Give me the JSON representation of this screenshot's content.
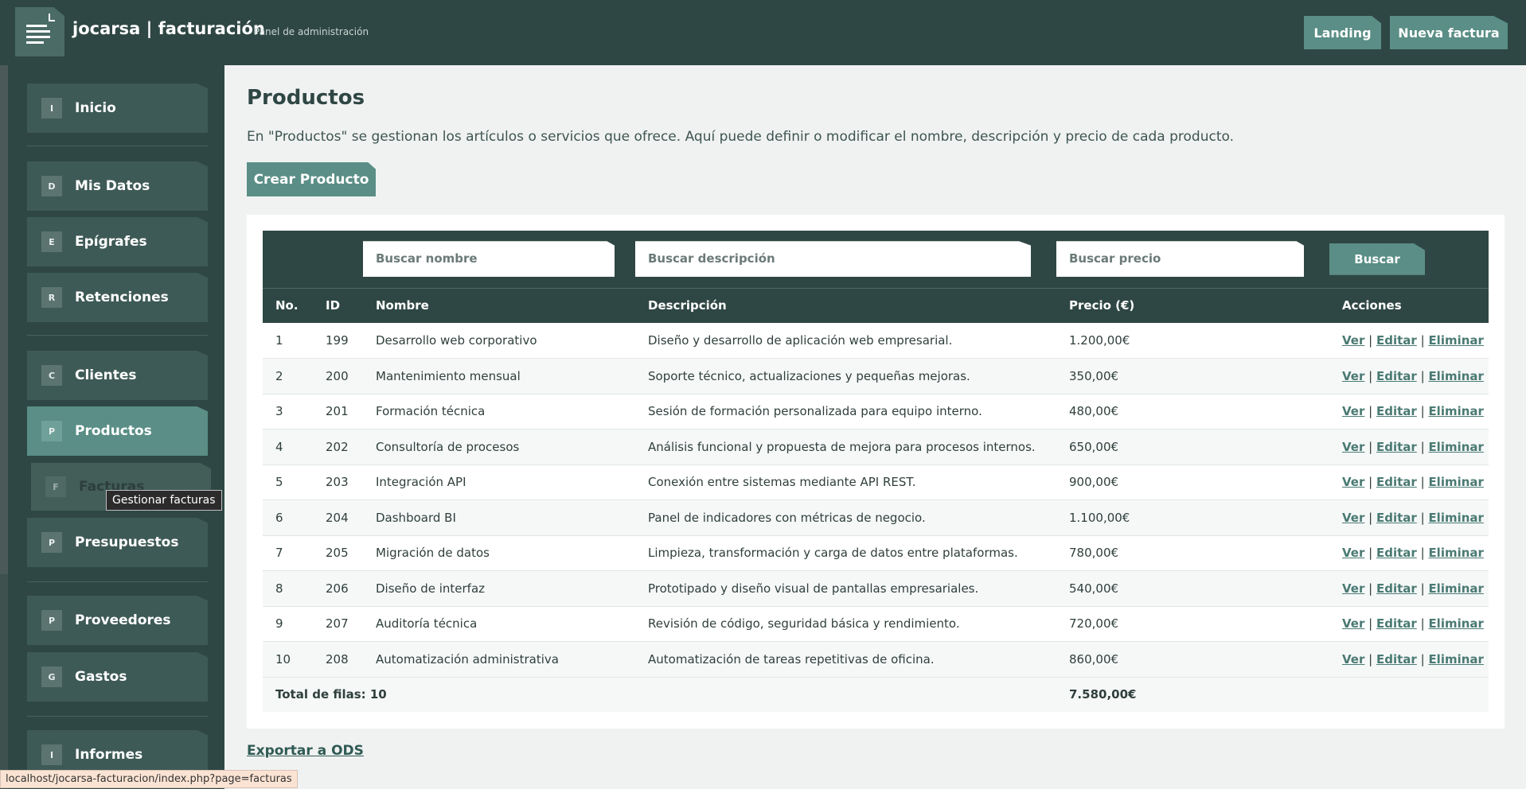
{
  "header": {
    "title": "jocarsa | facturación",
    "subtitle": "Panel de administración",
    "buttons": {
      "landing": "Landing",
      "new_invoice": "Nueva factura"
    }
  },
  "sidebar": {
    "items": [
      {
        "badge": "I",
        "label": "Inicio"
      },
      {
        "badge": "D",
        "label": "Mis Datos"
      },
      {
        "badge": "E",
        "label": "Epígrafes"
      },
      {
        "badge": "R",
        "label": "Retenciones"
      },
      {
        "badge": "C",
        "label": "Clientes"
      },
      {
        "badge": "P",
        "label": "Productos"
      },
      {
        "badge": "P",
        "label": "Presupuestos"
      },
      {
        "badge": "P",
        "label": "Proveedores"
      },
      {
        "badge": "G",
        "label": "Gastos"
      },
      {
        "badge": "I",
        "label": "Informes"
      }
    ],
    "active": "Productos",
    "hover_item": {
      "badge": "F",
      "label": "Facturas"
    },
    "tooltip": "Gestionar facturas"
  },
  "main": {
    "title": "Productos",
    "description": "En \"Productos\" se gestionan los artículos o servicios que ofrece. Aquí puede definir o modificar el nombre, descripción y precio de cada producto.",
    "create_button": "Crear Producto",
    "filters": {
      "name_placeholder": "Buscar nombre",
      "description_placeholder": "Buscar descripción",
      "price_placeholder": "Buscar precio",
      "search_button": "Buscar"
    },
    "table": {
      "headers": [
        "No.",
        "ID",
        "Nombre",
        "Descripción",
        "Precio (€)",
        "Acciones"
      ],
      "rows": [
        {
          "no": "1",
          "id": "199",
          "name": "Desarrollo web corporativo",
          "description": "Diseño y desarrollo de aplicación web empresarial.",
          "price": "1.200,00€"
        },
        {
          "no": "2",
          "id": "200",
          "name": "Mantenimiento mensual",
          "description": "Soporte técnico, actualizaciones y pequeñas mejoras.",
          "price": "350,00€"
        },
        {
          "no": "3",
          "id": "201",
          "name": "Formación técnica",
          "description": "Sesión de formación personalizada para equipo interno.",
          "price": "480,00€"
        },
        {
          "no": "4",
          "id": "202",
          "name": "Consultoría de procesos",
          "description": "Análisis funcional y propuesta de mejora para procesos internos.",
          "price": "650,00€"
        },
        {
          "no": "5",
          "id": "203",
          "name": "Integración API",
          "description": "Conexión entre sistemas mediante API REST.",
          "price": "900,00€"
        },
        {
          "no": "6",
          "id": "204",
          "name": "Dashboard BI",
          "description": "Panel de indicadores con métricas de negocio.",
          "price": "1.100,00€"
        },
        {
          "no": "7",
          "id": "205",
          "name": "Migración de datos",
          "description": "Limpieza, transformación y carga de datos entre plataformas.",
          "price": "780,00€"
        },
        {
          "no": "8",
          "id": "206",
          "name": "Diseño de interfaz",
          "description": "Prototipado y diseño visual de pantallas empresariales.",
          "price": "540,00€"
        },
        {
          "no": "9",
          "id": "207",
          "name": "Auditoría técnica",
          "description": "Revisión de código, seguridad básica y rendimiento.",
          "price": "720,00€"
        },
        {
          "no": "10",
          "id": "208",
          "name": "Automatización administrativa",
          "description": "Automatización de tareas repetitivas de oficina.",
          "price": "860,00€"
        }
      ],
      "actions": {
        "view": "Ver",
        "edit": "Editar",
        "delete": "Eliminar",
        "separator": "|"
      },
      "total_label": "Total de filas: 10",
      "total_price": "7.580,00€"
    },
    "export_link": "Exportar a ODS"
  },
  "statusbar": {
    "url": "localhost/jocarsa-facturacion/index.php?page=facturas"
  },
  "colors": {
    "header_bg": "#2f4744",
    "accent": "#5a8e86",
    "link": "#4a7a73"
  }
}
